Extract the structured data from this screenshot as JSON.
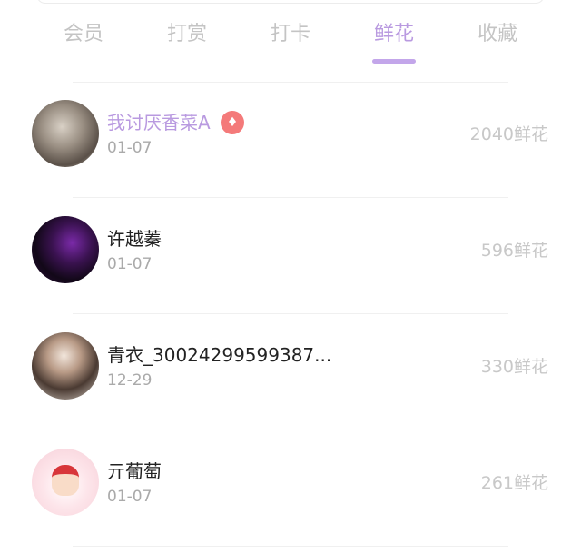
{
  "tabs": [
    {
      "label": "会员",
      "active": false
    },
    {
      "label": "打赏",
      "active": false
    },
    {
      "label": "打卡",
      "active": false
    },
    {
      "label": "鲜花",
      "active": true
    },
    {
      "label": "收藏",
      "active": false
    }
  ],
  "rows": [
    {
      "name": "我讨厌香菜A",
      "vip": true,
      "date": "01-07",
      "amount": "2040鲜花"
    },
    {
      "name": "许越蓁",
      "vip": false,
      "date": "01-07",
      "amount": "596鲜花"
    },
    {
      "name": "青衣_30024299599387...",
      "vip": false,
      "date": "12-29",
      "amount": "330鲜花"
    },
    {
      "name": "亓葡萄",
      "vip": false,
      "date": "01-07",
      "amount": "261鲜花"
    }
  ],
  "colors": {
    "accent": "#b99ae0",
    "vip_badge": "#f47a7a"
  },
  "icons": {
    "vip_badge": "diamond-icon"
  }
}
